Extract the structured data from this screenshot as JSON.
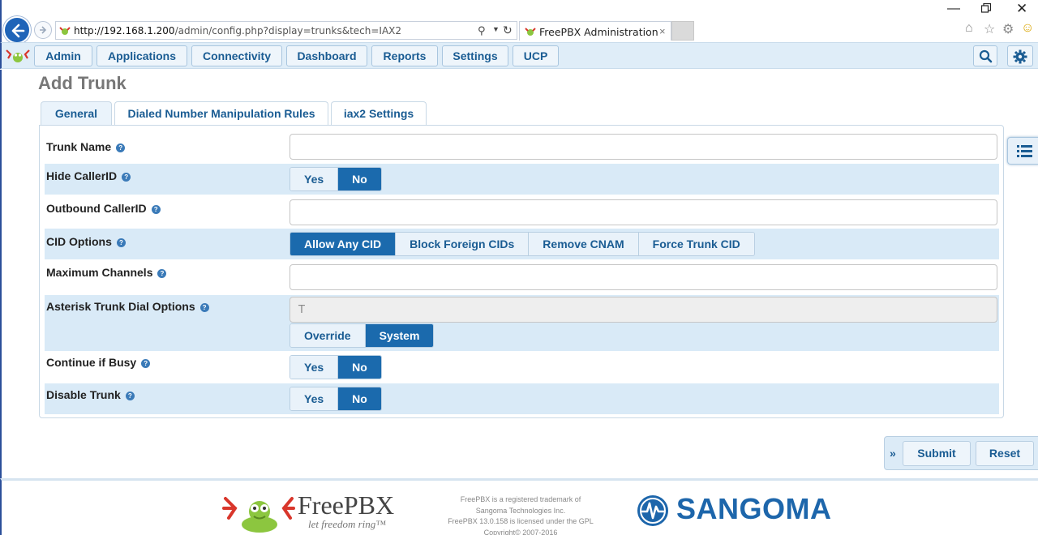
{
  "browser": {
    "url_host": "http://192.168.1.200",
    "url_path": "/admin/config.php?display=trunks&tech=IAX2",
    "tab_title": "FreePBX Administration",
    "tab_close": "×",
    "minimize": "—",
    "close": "✕"
  },
  "nav": {
    "items": [
      "Admin",
      "Applications",
      "Connectivity",
      "Dashboard",
      "Reports",
      "Settings",
      "UCP"
    ]
  },
  "page": {
    "title": "Add Trunk",
    "tabs": [
      "General",
      "Dialed Number Manipulation Rules",
      "iax2 Settings"
    ]
  },
  "form": {
    "trunk_name": {
      "label": "Trunk Name",
      "value": ""
    },
    "hide_callerid": {
      "label": "Hide CallerID",
      "yes": "Yes",
      "no": "No",
      "selected": "No"
    },
    "outbound_callerid": {
      "label": "Outbound CallerID",
      "value": ""
    },
    "cid_options": {
      "label": "CID Options",
      "options": [
        "Allow Any CID",
        "Block Foreign CIDs",
        "Remove CNAM",
        "Force Trunk CID"
      ],
      "selected": "Allow Any CID"
    },
    "max_channels": {
      "label": "Maximum Channels",
      "value": ""
    },
    "dial_options": {
      "label": "Asterisk Trunk Dial Options",
      "value": "T",
      "override": "Override",
      "system": "System",
      "selected": "System"
    },
    "continue_if_busy": {
      "label": "Continue if Busy",
      "yes": "Yes",
      "no": "No",
      "selected": "No"
    },
    "disable_trunk": {
      "label": "Disable Trunk",
      "yes": "Yes",
      "no": "No",
      "selected": "No"
    }
  },
  "actions": {
    "chevron": "»",
    "submit": "Submit",
    "reset": "Reset"
  },
  "footer": {
    "freepbx_name": "FreePBX",
    "freepbx_tagline": "let freedom ring™",
    "legal_lines": [
      "FreePBX is a registered trademark of",
      "Sangoma Technologies Inc.",
      "FreePBX 13.0.158 is licensed under the GPL",
      "Copyright© 2007-2016"
    ],
    "sangoma_name": "SANGOMA"
  },
  "colors": {
    "accent": "#1b6aad",
    "nav_bg": "#dfedf8",
    "row_shade": "#d9eaf7",
    "sangoma_blue": "#1d66ab"
  }
}
